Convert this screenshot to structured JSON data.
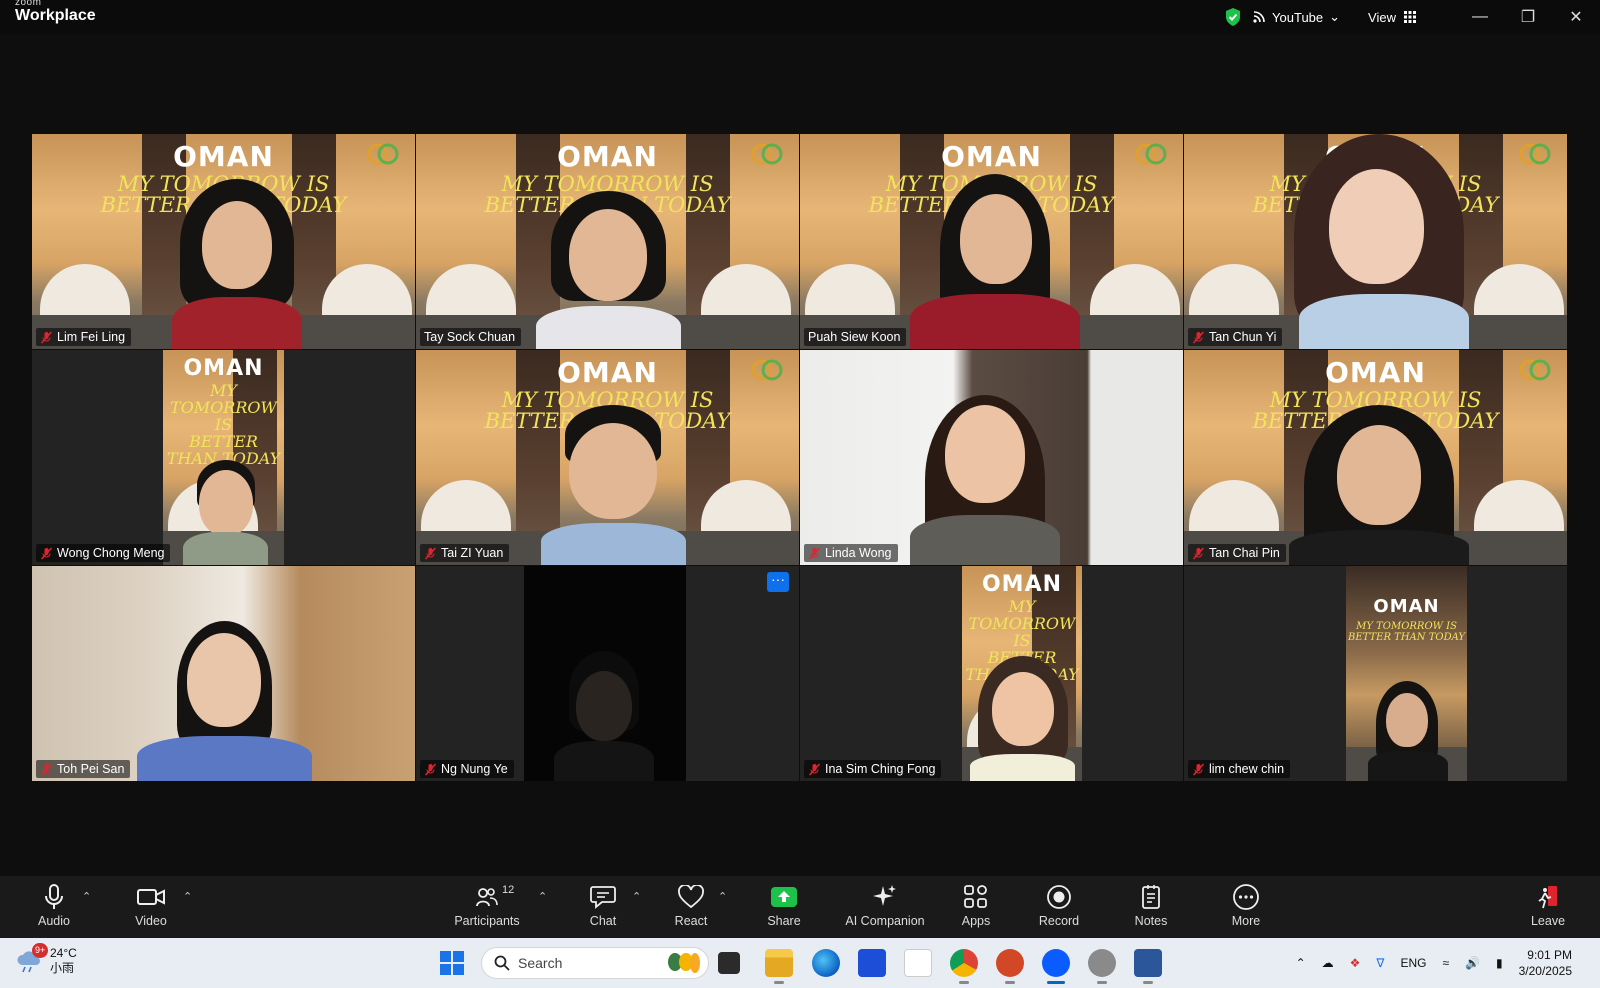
{
  "titlebar": {
    "logo_top": "zoom",
    "logo_bottom": "Workplace",
    "stream_label": "YouTube",
    "view_label": "View"
  },
  "participants": [
    {
      "name": "Lim Fei Ling",
      "muted": true,
      "background": "oman"
    },
    {
      "name": "Tay Sock Chuan",
      "muted": false,
      "background": "oman",
      "active_speaker": true
    },
    {
      "name": "Puah Siew Koon",
      "muted": false,
      "background": "oman"
    },
    {
      "name": "Tan Chun Yi",
      "muted": true,
      "background": "oman"
    },
    {
      "name": "Wong Chong Meng",
      "muted": true,
      "background": "oman-inset"
    },
    {
      "name": "Tai ZI Yuan",
      "muted": true,
      "background": "oman"
    },
    {
      "name": "Linda Wong",
      "muted": true,
      "background": "room"
    },
    {
      "name": "Tan Chai Pin",
      "muted": true,
      "background": "oman"
    },
    {
      "name": "Toh Pei San",
      "muted": true,
      "background": "kitchen"
    },
    {
      "name": "Ng Nung Ye",
      "muted": true,
      "background": "dark-inset"
    },
    {
      "name": "Ina Sim Ching Fong",
      "muted": true,
      "background": "oman-inset"
    },
    {
      "name": "lim chew chin",
      "muted": true,
      "background": "oman-inset"
    }
  ],
  "virtual_background": {
    "title": "OMAN",
    "line1": "MY TOMORROW IS",
    "line2": "BETTER THAN TODAY"
  },
  "toolbar": {
    "audio": "Audio",
    "video": "Video",
    "participants": "Participants",
    "participants_count": "12",
    "chat": "Chat",
    "react": "React",
    "share": "Share",
    "ai_companion": "AI Companion",
    "apps": "Apps",
    "record": "Record",
    "notes": "Notes",
    "more": "More",
    "leave": "Leave"
  },
  "taskbar": {
    "weather_temp": "24°C",
    "weather_desc": "小雨",
    "weather_badge": "9+",
    "search_placeholder": "Search",
    "language": "ENG",
    "time": "9:01 PM",
    "date": "3/20/2025"
  },
  "colors": {
    "active_speaker": "#23d18b",
    "share_green": "#1ec24b",
    "zoom_blue": "#0e71eb",
    "mute_red": "#e0242e"
  }
}
